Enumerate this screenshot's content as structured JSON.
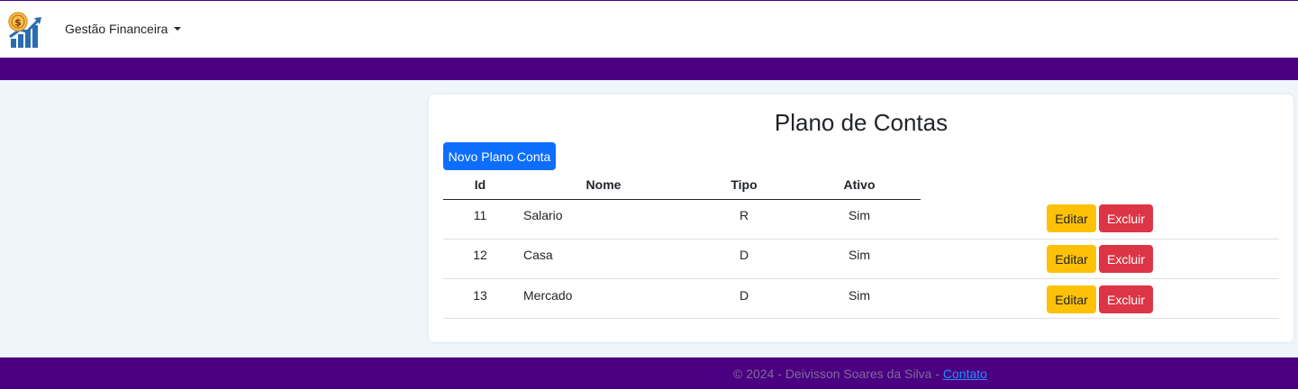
{
  "navbar": {
    "logo_icon": "finance-growth-logo-icon",
    "menu_label": "Gestão Financeira",
    "caret_icon": "caret-down-icon"
  },
  "main": {
    "title": "Plano de Contas",
    "new_button_label": "Novo Plano Conta",
    "columns": [
      "Id",
      "Nome",
      "Tipo",
      "Ativo"
    ],
    "rows": [
      {
        "id": "11",
        "nome": "Salario",
        "tipo": "R",
        "ativo": "Sim"
      },
      {
        "id": "12",
        "nome": "Casa",
        "tipo": "D",
        "ativo": "Sim"
      },
      {
        "id": "13",
        "nome": "Mercado",
        "tipo": "D",
        "ativo": "Sim"
      }
    ],
    "edit_label": "Editar",
    "delete_label": "Excluir"
  },
  "footer": {
    "text": "© 2024 - Deivisson Soares da Silva - ",
    "link_label": "Contato"
  },
  "colors": {
    "brand_purple": "#4b0082",
    "primary": "#0d6efd",
    "warning": "#ffc107",
    "danger": "#dc3545",
    "page_bg": "#eef6fc"
  }
}
